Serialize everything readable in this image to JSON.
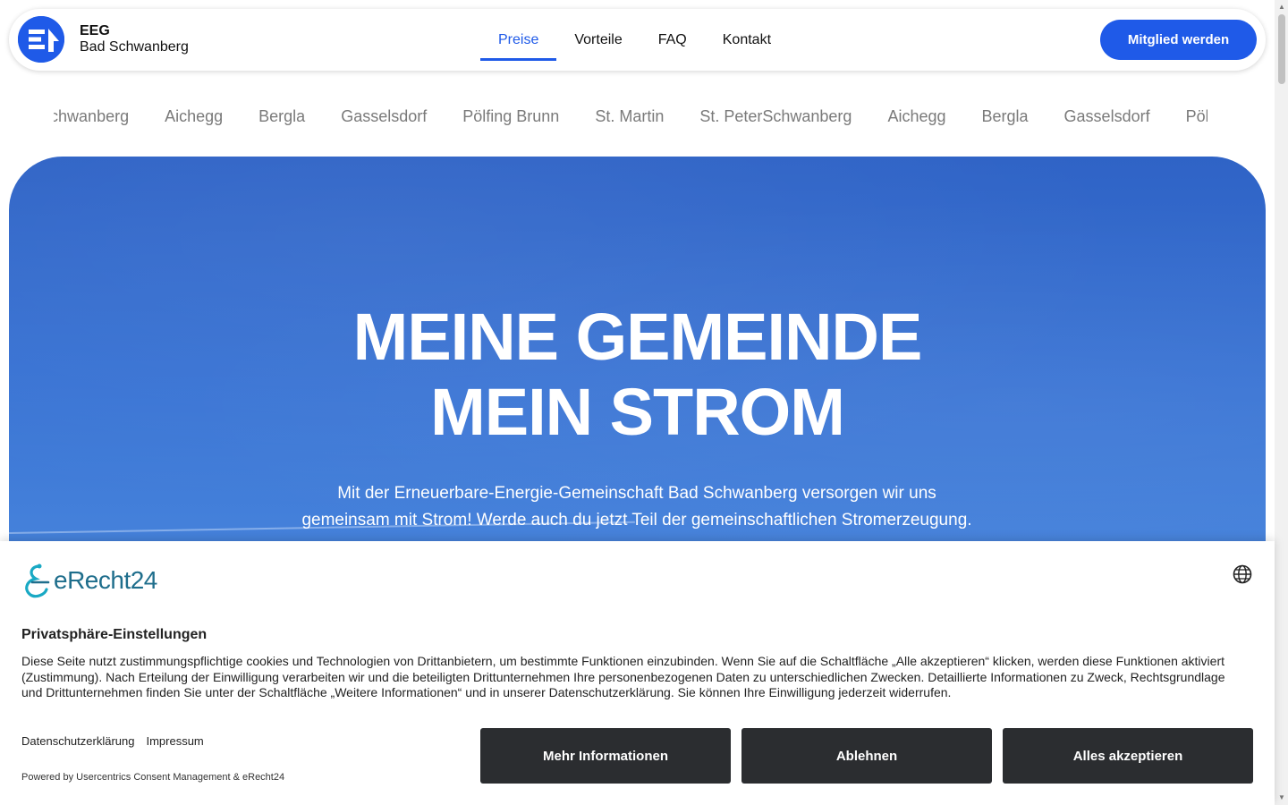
{
  "header": {
    "logo_line1": "EEG",
    "logo_line2": "Bad Schwanberg",
    "nav": [
      {
        "label": "Preise",
        "active": true
      },
      {
        "label": "Vorteile"
      },
      {
        "label": "FAQ"
      },
      {
        "label": "Kontakt"
      }
    ],
    "cta_label": "Mitglied werden"
  },
  "marquee": [
    "Bad Schwanberg",
    "Aichegg",
    "Bergla",
    "Gasselsdorf",
    "Pölfing Brunn",
    "St. Martin",
    "St. PeterSchwanberg",
    "Aichegg",
    "Bergla",
    "Gasselsdorf",
    "Pölfing Brunn"
  ],
  "hero": {
    "title_line1": "MEINE GEMEINDE",
    "title_line2": "MEIN STROM",
    "subtitle": "Mit der Erneuerbare-Energie-Gemeinschaft Bad Schwanberg versorgen wir uns gemeinsam mit Strom! Werde auch du jetzt Teil der gemeinschaftlichen Stromerzeugung."
  },
  "consent": {
    "brand": "eRecht24",
    "heading": "Privatsphäre-Einstellungen",
    "text": "Diese Seite nutzt zustimmungspflichtige cookies und Technologien von Drittanbietern, um bestimmte Funktionen einzubinden. Wenn Sie auf die Schaltfläche „Alle akzeptieren“ klicken, werden diese Funktionen aktiviert (Zustimmung). Nach Erteilung der Einwilligung verarbeiten wir und die beteiligten Drittunternehmen Ihre personenbezogenen Daten zu unterschiedlichen Zwecken. Detaillierte Informationen zu Zweck, Rechtsgrundlage und Drittunternehmen finden Sie unter der Schaltfläche „Weitere Informationen“ und in unserer Datenschutzerklärung. Sie können Ihre Einwilligung jederzeit widerrufen.",
    "link_privacy": "Datenschutzerklärung",
    "link_imprint": "Impressum",
    "powered_by": "Powered by Usercentrics Consent Management & eRecht24",
    "btn_more": "Mehr Informationen",
    "btn_decline": "Ablehnen",
    "btn_accept": "Alles akzeptieren"
  },
  "colors": {
    "brand_blue": "#1f5ae8",
    "hero_blue": "#3a74d4",
    "consent_button": "#2b2d30"
  }
}
